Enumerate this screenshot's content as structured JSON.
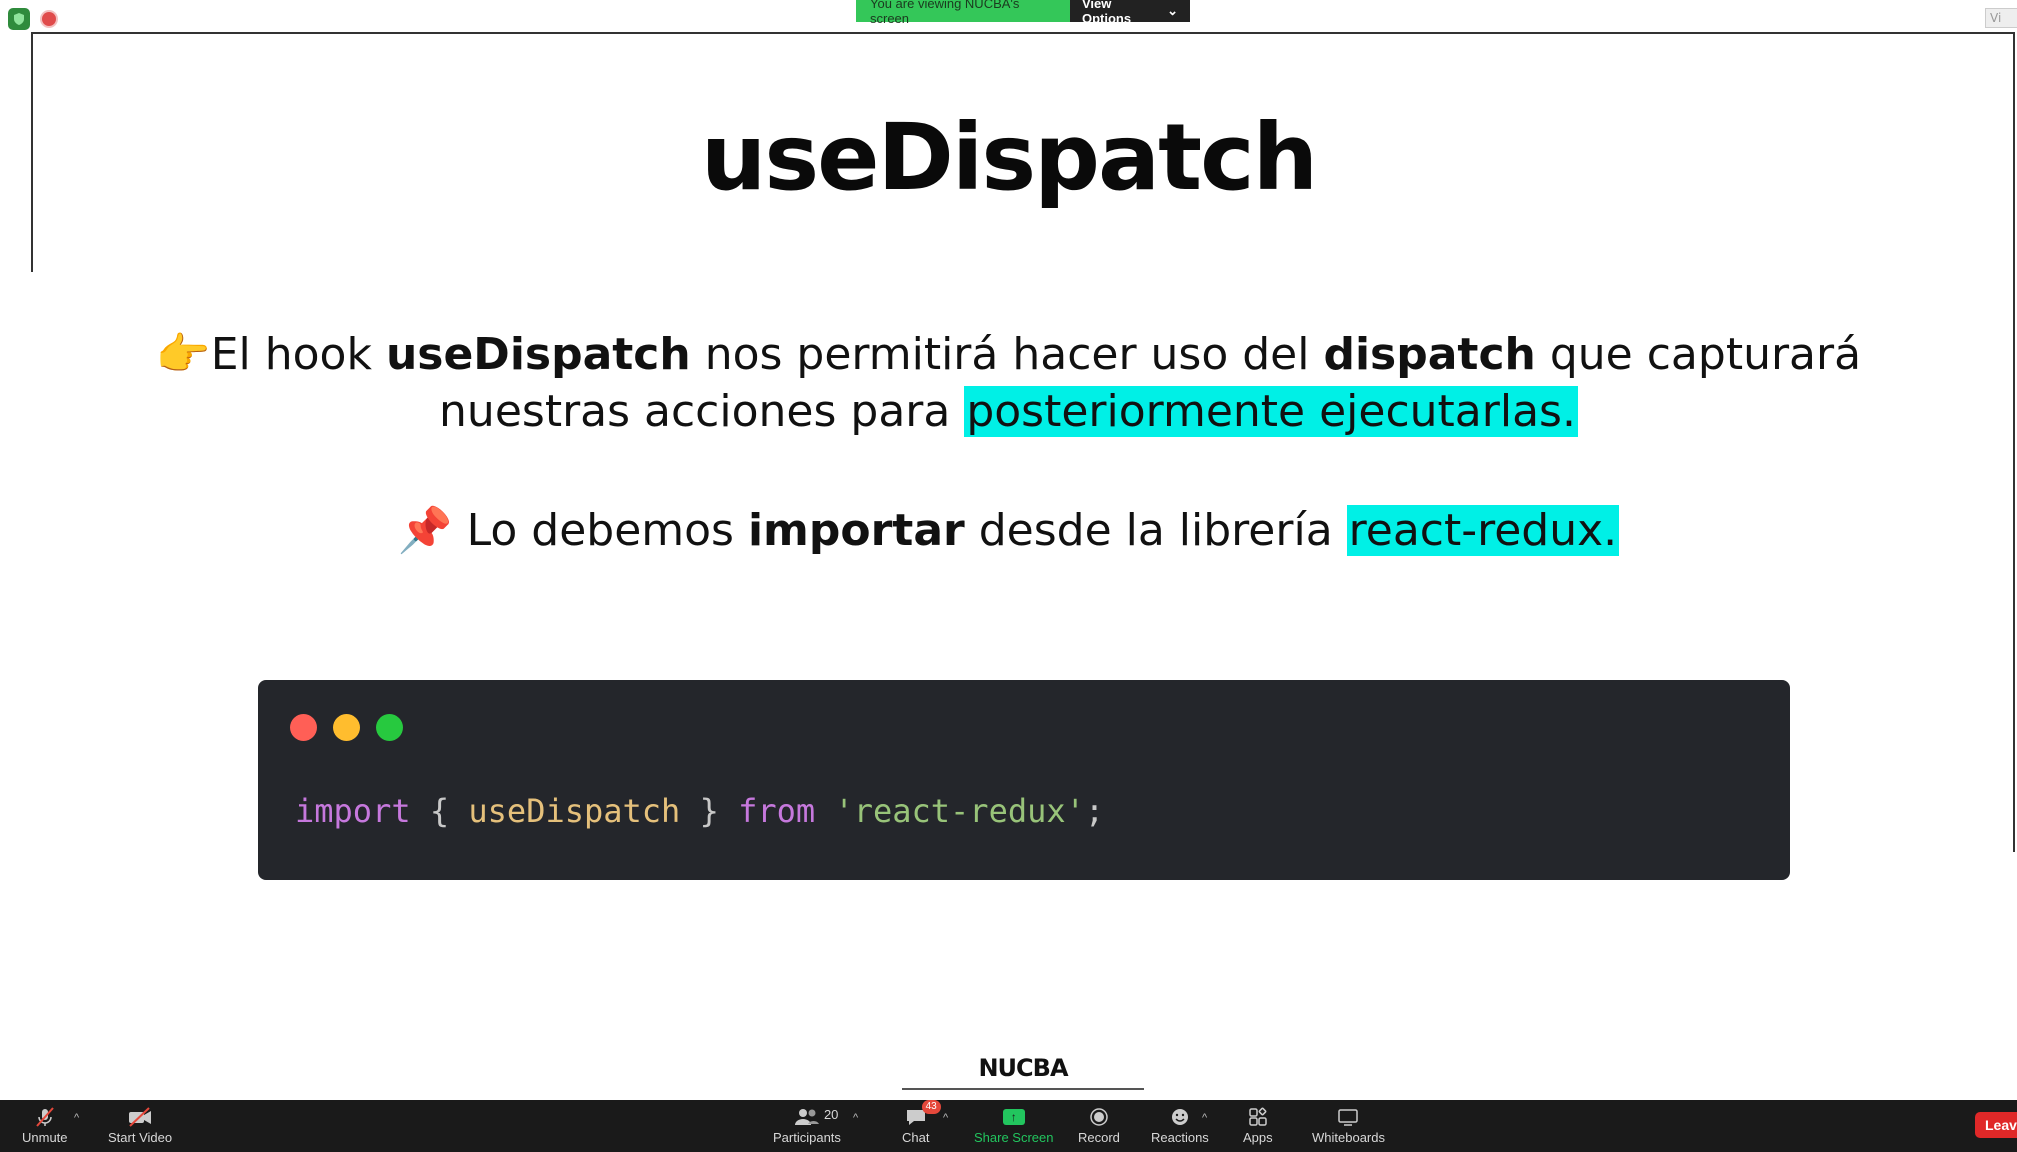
{
  "banner": {
    "viewing_text": "You are viewing NUCBA's screen",
    "view_options": "View Options"
  },
  "top_right": {
    "label": "Vi"
  },
  "slide": {
    "title": "useDispatch",
    "p1_emoji": "👉",
    "p1_a": "El hook ",
    "p1_b": "useDispatch",
    "p1_c": " nos permitirá hacer uso del ",
    "p1_d": "dispatch",
    "p1_e": " que capturará",
    "p2_a": "nuestras acciones para ",
    "p2_hl": "posteriormente ejecutarlas.",
    "p3_emoji": "📌",
    "p3_a": " Lo debemos ",
    "p3_b": "importar",
    "p3_c": " desde la librería ",
    "p3_hl": "react-redux.",
    "code": {
      "import": "import",
      "open": " { ",
      "fn": "useDispatch",
      "close": " } ",
      "from": "from",
      "space": " ",
      "str": "'react-redux'",
      "semi": ";"
    },
    "brand": "NUCBA"
  },
  "colors": {
    "dot_red": "#ff5f56",
    "dot_yellow": "#ffbd2e",
    "dot_green": "#27c93f"
  },
  "toolbar": {
    "unmute": "Unmute",
    "start_video": "Start Video",
    "participants": "Participants",
    "participants_count": "20",
    "chat": "Chat",
    "chat_badge": "43",
    "share_screen": "Share Screen",
    "record": "Record",
    "reactions": "Reactions",
    "apps": "Apps",
    "whiteboards": "Whiteboards",
    "leave": "Leave"
  }
}
